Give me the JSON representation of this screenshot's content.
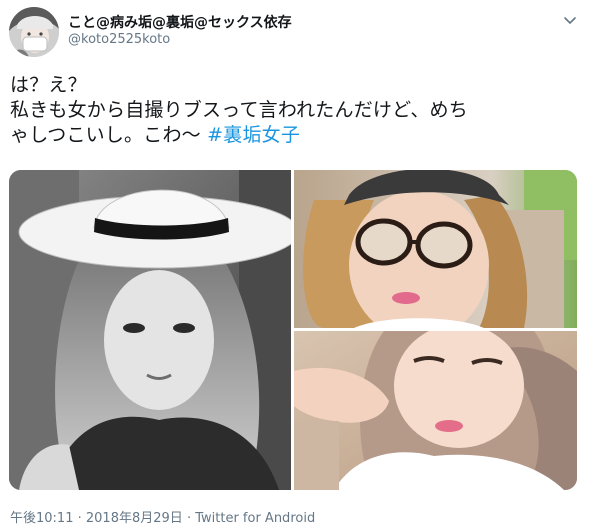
{
  "user": {
    "display_name": "こと@病み垢@裏垢@セックス依存",
    "handle": "@koto2525koto"
  },
  "tweet": {
    "line1": "は？え？",
    "line2": "私きも女から自撮りブスって言われたんだけど、めち",
    "line3": "ゃしつこいし。こわ〜",
    "hashtag": "#裏垢女子"
  },
  "meta": {
    "time": "午後10:11",
    "sep1": "·",
    "date": "2018年8月29日",
    "sep2": "·",
    "source": "Twitter for Android"
  },
  "colors": {
    "text": "#14171a",
    "secondary": "#657786",
    "link": "#1b95e0"
  },
  "icons": {
    "menu": "chevron-down-icon"
  }
}
